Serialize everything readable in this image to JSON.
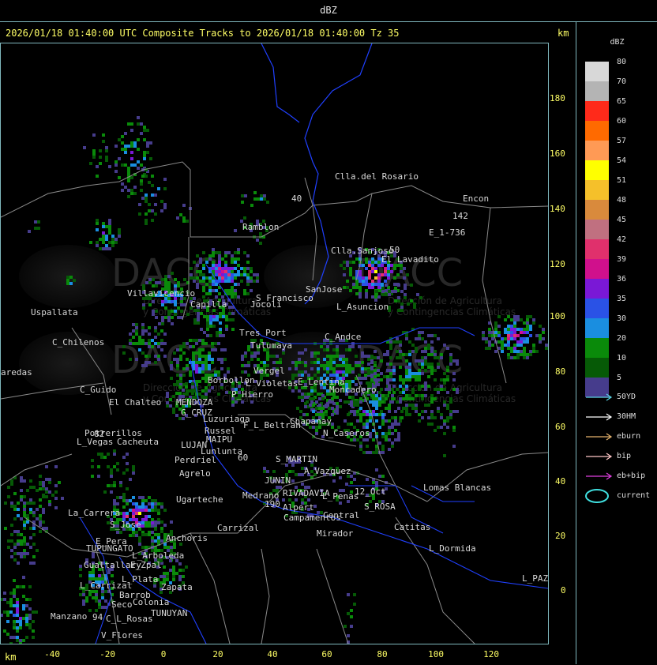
{
  "window": {
    "title": "dBZ"
  },
  "header": {
    "title": "2026/01/18 01:40:00 UTC Composite Tracks to 2026/01/18 01:40:00 Tz 35",
    "km_label_top": "km",
    "km_label_bottom": "km"
  },
  "axes": {
    "y_ticks": [
      "180",
      "160",
      "140",
      "120",
      "100",
      "80",
      "60",
      "40",
      "20",
      "0"
    ],
    "x_ticks": [
      "-40",
      "-20",
      "0",
      "20",
      "40",
      "60",
      "80",
      "100",
      "120"
    ]
  },
  "legend": {
    "title": "dBZ",
    "scale": [
      {
        "label": "80",
        "color": "#d8d8d8"
      },
      {
        "label": "70",
        "color": "#b4b4b4"
      },
      {
        "label": "65",
        "color": "#ff2a1a"
      },
      {
        "label": "60",
        "color": "#ff6a00"
      },
      {
        "label": "57",
        "color": "#ff9a55"
      },
      {
        "label": "54",
        "color": "#ffff00"
      },
      {
        "label": "51",
        "color": "#f5c02a"
      },
      {
        "label": "48",
        "color": "#d98a3c"
      },
      {
        "label": "45",
        "color": "#c07080"
      },
      {
        "label": "42",
        "color": "#e0306c"
      },
      {
        "label": "39",
        "color": "#d0108c"
      },
      {
        "label": "36",
        "color": "#7a18d6"
      },
      {
        "label": "35",
        "color": "#2a52e6"
      },
      {
        "label": "30",
        "color": "#1a8ee0"
      },
      {
        "label": "20",
        "color": "#0a8a0a"
      },
      {
        "label": "10",
        "color": "#065a06"
      },
      {
        "label": "5",
        "color": "#463c8c"
      }
    ],
    "tracks": [
      {
        "label": "50YD",
        "color": "#5cd4e6"
      },
      {
        "label": "30HM",
        "color": "#ffffff"
      },
      {
        "label": "eburn",
        "color": "#e6b46e"
      },
      {
        "label": "bip",
        "color": "#ffc8c8"
      },
      {
        "label": "eb+bip",
        "color": "#e040e0"
      },
      {
        "label": "current",
        "color": "#40e0e0"
      }
    ]
  },
  "map": {
    "watermark": {
      "text": "DACC",
      "caption_line1": "Dirección de Agricultura",
      "caption_line2": "y Contingencias Climáticas"
    },
    "places": [
      {
        "id": "clla-del-rosario",
        "label": "Clla.del Rosario"
      },
      {
        "id": "encon",
        "label": "Encon"
      },
      {
        "id": "e1-736",
        "label": "E_1-736"
      },
      {
        "id": "n142",
        "label": "142"
      },
      {
        "id": "ramblon",
        "label": "Ramblon"
      },
      {
        "id": "clla-sanjose",
        "label": "Clla.Sanjose"
      },
      {
        "id": "el-lavadito",
        "label": "El Lavadito"
      },
      {
        "id": "sanjose",
        "label": "SanJose"
      },
      {
        "id": "s-francisco",
        "label": "S_Francisco"
      },
      {
        "id": "l-asuncion",
        "label": "L_Asuncion"
      },
      {
        "id": "villavicencio",
        "label": "Villavicencio"
      },
      {
        "id": "capilla",
        "label": "Capilla"
      },
      {
        "id": "uspallata",
        "label": "Uspallata"
      },
      {
        "id": "c-chilenos",
        "label": "C_Chilenos"
      },
      {
        "id": "redes",
        "label": "aredas"
      },
      {
        "id": "tres-port",
        "label": "Tres Port"
      },
      {
        "id": "tulumaya",
        "label": "Tulumaya"
      },
      {
        "id": "c-andce",
        "label": "C_Andce"
      },
      {
        "id": "jocoli",
        "label": "Jocoli"
      },
      {
        "id": "vergel",
        "label": "Vergel"
      },
      {
        "id": "l-violetas",
        "label": "L Violetas"
      },
      {
        "id": "el-borbollon",
        "label": "Borbollon"
      },
      {
        "id": "p-hierro",
        "label": "P_Hierro"
      },
      {
        "id": "c-guido",
        "label": "C_Guido"
      },
      {
        "id": "el-chalteo",
        "label": "El Chalteo"
      },
      {
        "id": "mendoza",
        "label": "MENDOZA"
      },
      {
        "id": "g-cruz",
        "label": "G_CRUZ"
      },
      {
        "id": "e-lentina",
        "label": "E_Lentina"
      },
      {
        "id": "moncadero",
        "label": "Moncadero"
      },
      {
        "id": "luzuriaga",
        "label": "Luzuriaga"
      },
      {
        "id": "russel",
        "label": "Russel"
      },
      {
        "id": "maipu",
        "label": "MAIPU"
      },
      {
        "id": "f-l-beltran",
        "label": "F_L_Beltran"
      },
      {
        "id": "chapanay",
        "label": "Chapanay"
      },
      {
        "id": "n-caseros",
        "label": "N_Caseros"
      },
      {
        "id": "potrerillos",
        "label": "Potrerillos"
      },
      {
        "id": "l-vegas",
        "label": "L_Vegas"
      },
      {
        "id": "cacheuta",
        "label": "Cacheuta"
      },
      {
        "id": "lujan",
        "label": "LUJAN"
      },
      {
        "id": "lunlunta",
        "label": "Lunlunta"
      },
      {
        "id": "perdriel",
        "label": "Perdriel"
      },
      {
        "id": "s-martin",
        "label": "S_MARTIN"
      },
      {
        "id": "a-vazquez",
        "label": "A_Vazquez"
      },
      {
        "id": "agrelo",
        "label": "Agrelo"
      },
      {
        "id": "rivadavia",
        "label": "RIVADAVIA"
      },
      {
        "id": "n12-oct",
        "label": "12_Oct"
      },
      {
        "id": "junin",
        "label": "JUNIN"
      },
      {
        "id": "l-penas",
        "label": "L_Penas"
      },
      {
        "id": "ugarteche",
        "label": "Ugarteche"
      },
      {
        "id": "medrano",
        "label": "Medrano"
      },
      {
        "id": "alpert",
        "label": "Alpert"
      },
      {
        "id": "campamentos",
        "label": "Campamentos"
      },
      {
        "id": "central",
        "label": "Central"
      },
      {
        "id": "s-rosa",
        "label": "S_ROSA"
      },
      {
        "id": "lomas-blancas",
        "label": "Lomas Blancas"
      },
      {
        "id": "catitas",
        "label": "Catitas"
      },
      {
        "id": "la-carrera",
        "label": "La_Carrera"
      },
      {
        "id": "s-jose",
        "label": "S_Jose"
      },
      {
        "id": "carrizal",
        "label": "Carrizal"
      },
      {
        "id": "anchoris",
        "label": "Anchoris"
      },
      {
        "id": "mirador",
        "label": "Mirador"
      },
      {
        "id": "l-dormida",
        "label": "L_Dormida"
      },
      {
        "id": "e-pera",
        "label": "E_Pera"
      },
      {
        "id": "tupungato",
        "label": "TUPUNGATO"
      },
      {
        "id": "e-zpal",
        "label": "E_Zpal"
      },
      {
        "id": "l-arboleda",
        "label": "L_Arboleda"
      },
      {
        "id": "gualtallary",
        "label": "Gualtallary"
      },
      {
        "id": "l-plata",
        "label": "L_Plata"
      },
      {
        "id": "zapata",
        "label": "Zapata"
      },
      {
        "id": "l-paz",
        "label": "L_PAZ"
      },
      {
        "id": "l-carrizal",
        "label": "L_Carrizal"
      },
      {
        "id": "colonia",
        "label": "Colonia"
      },
      {
        "id": "barrob",
        "label": "Barrob"
      },
      {
        "id": "seco",
        "label": "Seco"
      },
      {
        "id": "tunuyan",
        "label": "TUNUYAN"
      },
      {
        "id": "manzano",
        "label": "Manzano"
      },
      {
        "id": "c-l-rosas",
        "label": "C_L_Rosas"
      },
      {
        "id": "v-flores",
        "label": "V_Flores"
      },
      {
        "id": "n40",
        "label": "40"
      },
      {
        "id": "n50",
        "label": "50"
      },
      {
        "id": "n60",
        "label": "60"
      },
      {
        "id": "n82",
        "label": "82"
      },
      {
        "id": "n94",
        "label": "94"
      },
      {
        "id": "n190",
        "label": "190"
      }
    ]
  }
}
